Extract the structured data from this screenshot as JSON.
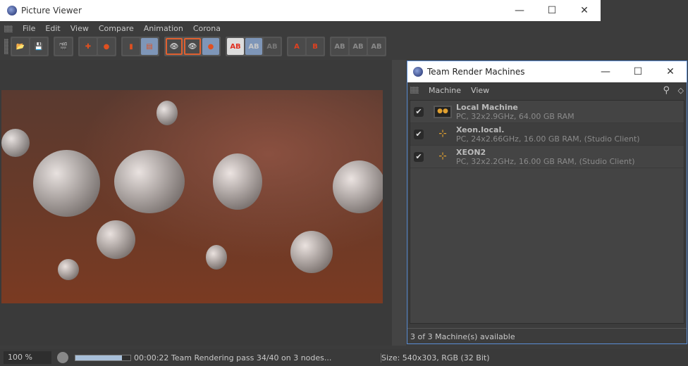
{
  "window": {
    "title": "Picture Viewer",
    "minimize": "—",
    "maximize": "☐",
    "close": "✕"
  },
  "menu": [
    "File",
    "Edit",
    "View",
    "Compare",
    "Animation",
    "Corona"
  ],
  "toolbar": {
    "groups": [
      [
        "open",
        "save-as"
      ],
      [
        "clapper"
      ],
      [
        "add-region",
        "user-down"
      ],
      [
        "delete-copy",
        "copy-layers"
      ],
      [
        "view-a",
        "view-b",
        "view-c"
      ],
      [
        "AB",
        "AB-swap",
        "AB-dim"
      ],
      [
        "A",
        "B"
      ],
      [
        "AB-split1",
        "AB-split2",
        "AB-split3"
      ]
    ],
    "accent": "#7e96b8"
  },
  "status": {
    "zoom": "100 %",
    "progress_percent": 85,
    "message": "00:00:22 Team Rendering pass 34/40 on 3 nodes...",
    "size": "Size: 540x303, RGB (32 Bit)"
  },
  "team_render": {
    "title": "Team Render Machines",
    "minimize": "—",
    "maximize": "☐",
    "close": "✕",
    "menu": [
      "Machine",
      "View"
    ],
    "machines": [
      {
        "name": "Local Machine",
        "info": "PC, 32x2.9GHz, 64.00 GB RAM",
        "checked": true,
        "icon": "monitor-icon"
      },
      {
        "name": "Xeon.local.",
        "info": "PC, 24x2.66GHz, 16.00 GB RAM, (Studio Client)",
        "checked": true,
        "icon": "network-node-icon"
      },
      {
        "name": "XEON2",
        "info": "PC, 32x2.2GHz, 16.00 GB RAM, (Studio Client)",
        "checked": true,
        "icon": "network-node-icon"
      }
    ],
    "footer": "3 of 3 Machine(s) available"
  }
}
